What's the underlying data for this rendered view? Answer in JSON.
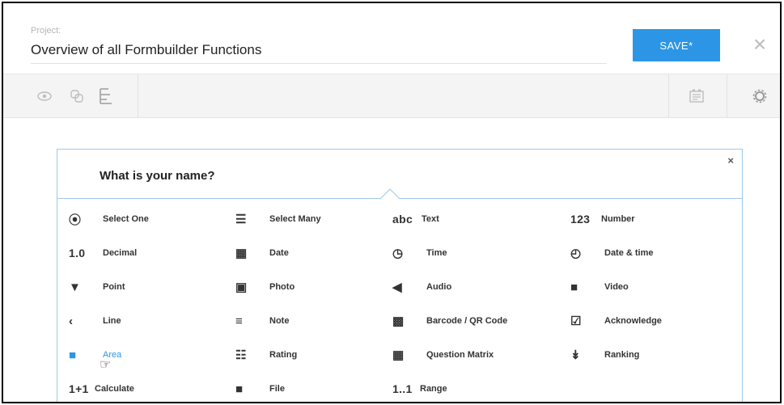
{
  "header": {
    "project_label": "Project:",
    "project_title": "Overview of all Formbuilder Functions",
    "save_label": "SAVE*",
    "close_symbol": "×"
  },
  "toolbar": {
    "icons": [
      "eye-icon",
      "copy-icon",
      "logic-icon",
      "translate-icon",
      "settings-icon"
    ]
  },
  "card": {
    "question": "What is your name?",
    "close_symbol": "×"
  },
  "question_types": [
    {
      "label": "Select One",
      "icon": "⦿"
    },
    {
      "label": "Select Many",
      "icon": "☰"
    },
    {
      "label": "Text",
      "icon": "abc"
    },
    {
      "label": "Number",
      "icon": "123"
    },
    {
      "label": "Decimal",
      "icon": "1.0"
    },
    {
      "label": "Date",
      "icon": "▦"
    },
    {
      "label": "Time",
      "icon": "◷"
    },
    {
      "label": "Date & time",
      "icon": "◴"
    },
    {
      "label": "Point",
      "icon": "▼"
    },
    {
      "label": "Photo",
      "icon": "▣"
    },
    {
      "label": "Audio",
      "icon": "◀"
    },
    {
      "label": "Video",
      "icon": "■"
    },
    {
      "label": "Line",
      "icon": "‹"
    },
    {
      "label": "Note",
      "icon": "≡"
    },
    {
      "label": "Barcode / QR Code",
      "icon": "▩"
    },
    {
      "label": "Acknowledge",
      "icon": "☑"
    },
    {
      "label": "Area",
      "icon": "■"
    },
    {
      "label": "Rating",
      "icon": "☷"
    },
    {
      "label": "Question Matrix",
      "icon": "▦"
    },
    {
      "label": "Ranking",
      "icon": "↡"
    },
    {
      "label": "Calculate",
      "icon": "1+1"
    },
    {
      "label": "File",
      "icon": "■"
    },
    {
      "label": "Range",
      "icon": "1..1"
    }
  ],
  "colors": {
    "accent": "#2d95e5",
    "card_border": "#9ec9e6"
  }
}
